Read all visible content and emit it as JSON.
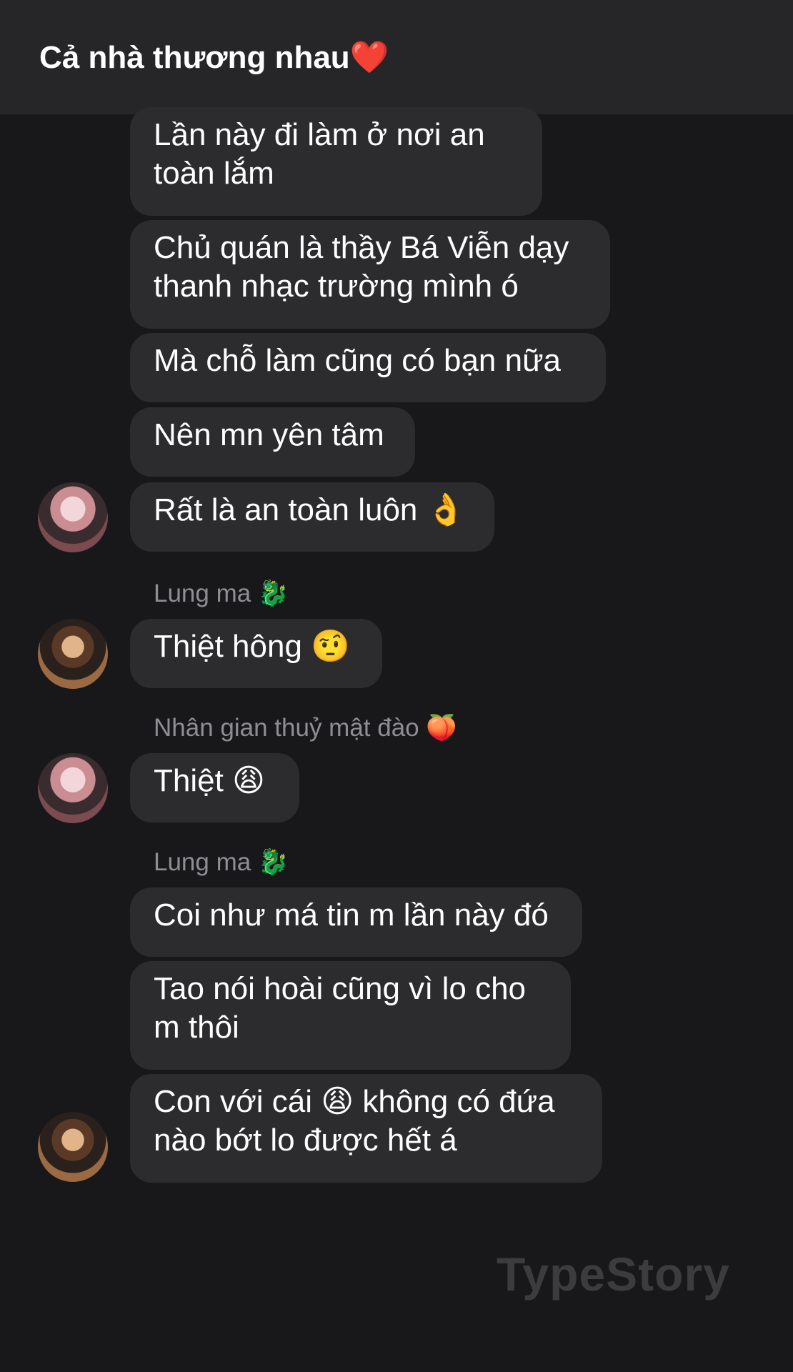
{
  "header": {
    "title": "Cả nhà thương nhau❤️"
  },
  "messages": [
    {
      "text": "Lần này đi làm ở nơi an\ntoàn lắm"
    },
    {
      "text": "Chủ quán là thầy Bá Viễn dạy\nthanh nhạc trường mình ó"
    },
    {
      "text": "Mà chỗ làm cũng có bạn nữa"
    },
    {
      "text": "Nên mn yên tâm"
    },
    {
      "text": "Rất là an toàn luôn 👌"
    },
    {
      "sender": "Lung ma 🐉",
      "text": "Thiệt hông 🤨"
    },
    {
      "sender": "Nhân gian thuỷ mật đào 🍑",
      "text": "Thiệt 😩"
    },
    {
      "sender": "Lung ma 🐉",
      "text": "Coi như má tin m lần này đó"
    },
    {
      "text": "Tao nói hoài cũng vì lo cho\nm thôi"
    },
    {
      "text": "Con với cái 😩 không có đứa\nnào bớt lo được hết á"
    }
  ],
  "watermark": "TypeStory"
}
